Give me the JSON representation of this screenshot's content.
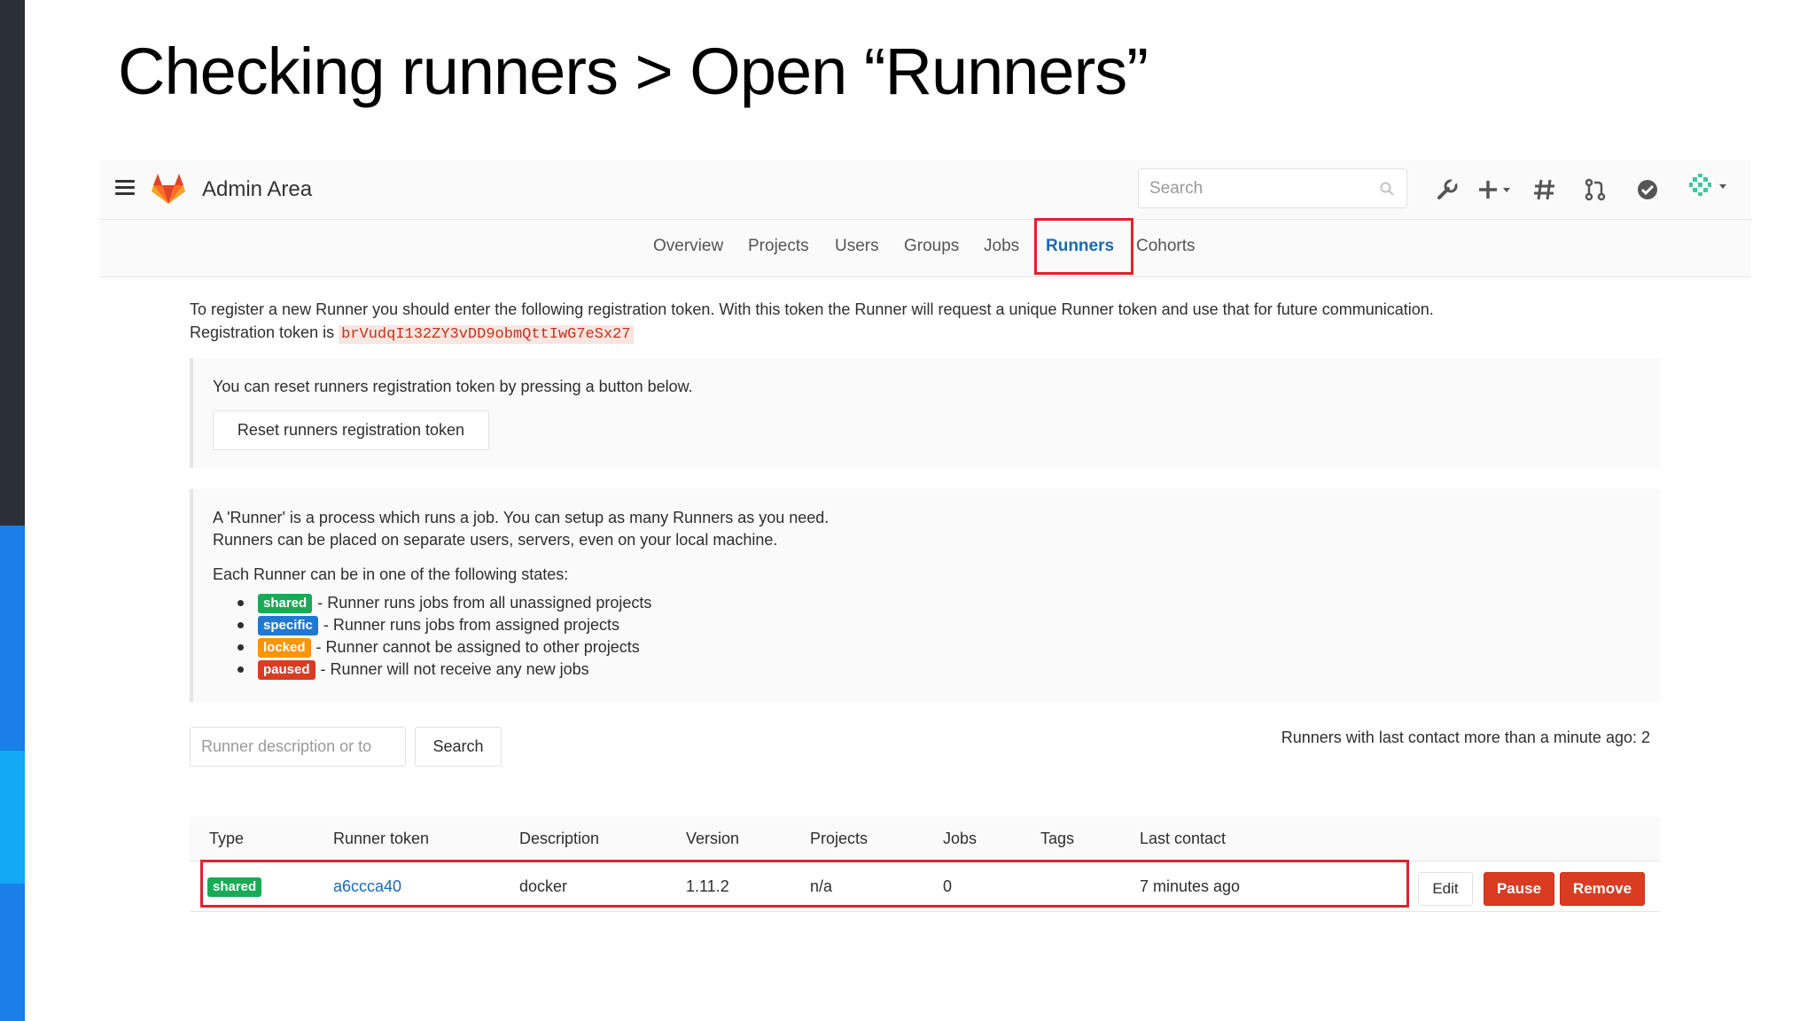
{
  "slide": {
    "title": "Checking runners > Open “Runners”"
  },
  "header": {
    "app_title": "Admin Area",
    "search_placeholder": "Search",
    "icons": [
      "wrench-icon",
      "plus-icon",
      "hash-icon",
      "merge-request-icon",
      "check-circle-icon",
      "avatar"
    ]
  },
  "nav": {
    "tabs": [
      "Overview",
      "Projects",
      "Users",
      "Groups",
      "Jobs",
      "Runners",
      "Cohorts"
    ],
    "active": "Runners"
  },
  "intro": {
    "line1": "To register a new Runner you should enter the following registration token. With this token the Runner will request a unique Runner token and use that for future communication.",
    "token_label": "Registration token is",
    "token": "brVudqI132ZY3vDD9obmQttIwG7eSx27"
  },
  "reset_panel": {
    "text": "You can reset runners registration token by pressing a button below.",
    "button": "Reset runners registration token"
  },
  "info_panel": {
    "line1": "A 'Runner' is a process which runs a job. You can setup as many Runners as you need.",
    "line2": "Runners can be placed on separate users, servers, even on your local machine.",
    "states_intro": "Each Runner can be in one of the following states:",
    "states": [
      {
        "badge": "shared",
        "text": "- Runner runs jobs from all unassigned projects",
        "color": "#1aaa55"
      },
      {
        "badge": "specific",
        "text": "- Runner runs jobs from assigned projects",
        "color": "#1f78d1"
      },
      {
        "badge": "locked",
        "text": "- Runner cannot be assigned to other projects",
        "color": "#fc9403"
      },
      {
        "badge": "paused",
        "text": "- Runner will not receive any new jobs",
        "color": "#db3b21"
      }
    ]
  },
  "filter": {
    "placeholder": "Runner description or to",
    "button": "Search",
    "contact_note": "Runners with last contact more than a minute ago: 2"
  },
  "table": {
    "headers": [
      "Type",
      "Runner token",
      "Description",
      "Version",
      "Projects",
      "Jobs",
      "Tags",
      "Last contact"
    ],
    "rows": [
      {
        "type": "shared",
        "token": "a6ccca40",
        "description": "docker",
        "version": "1.11.2",
        "projects": "n/a",
        "jobs": "0",
        "tags": "",
        "last_contact": "7 minutes ago",
        "actions": [
          "Edit",
          "Pause",
          "Remove"
        ]
      }
    ]
  },
  "colors": {
    "accent": "#1b69b6",
    "highlight": "#e0222b",
    "danger": "#db3b21"
  }
}
